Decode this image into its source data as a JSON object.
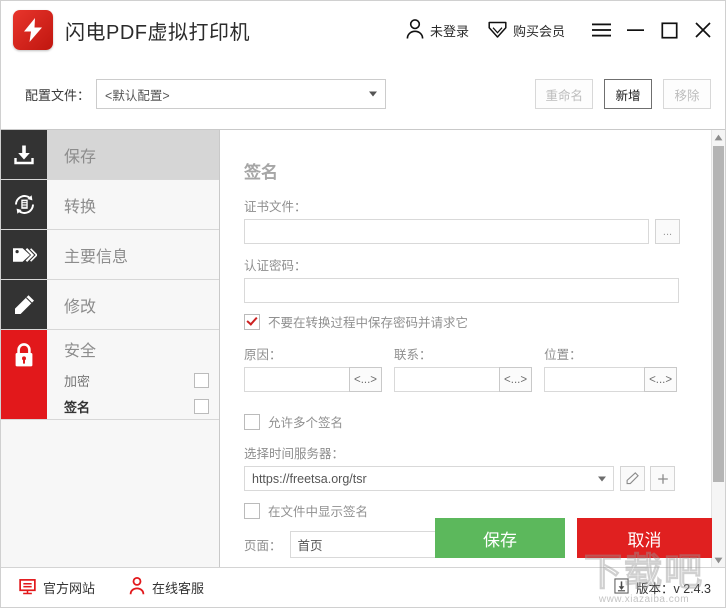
{
  "titlebar": {
    "app_title": "闪电PDF虚拟打印机",
    "logo_icon": "lightning-bolt-logo",
    "login_label": "未登录",
    "login_icon": "person-icon",
    "vip_label": "购买会员",
    "vip_icon": "diamond-icon",
    "menu_icon": "hamburger-menu-icon",
    "minimize_icon": "minimize-icon",
    "maximize_icon": "maximize-icon",
    "close_icon": "close-icon"
  },
  "configbar": {
    "label": "配置文件：",
    "selected_profile": "<默认配置>",
    "rename_label": "重命名",
    "add_label": "新增",
    "remove_label": "移除"
  },
  "sidebar": {
    "items": [
      {
        "label": "保存",
        "icon": "download-icon",
        "active": true
      },
      {
        "label": "转换",
        "icon": "convert-refresh-icon",
        "active": false
      },
      {
        "label": "主要信息",
        "icon": "tags-icon",
        "active": false
      },
      {
        "label": "修改",
        "icon": "pencil-icon",
        "active": false
      }
    ],
    "security": {
      "label": "安全",
      "icon": "lock-icon",
      "sub_items": [
        {
          "label": "加密",
          "checked": false,
          "selected": false
        },
        {
          "label": "签名",
          "checked": false,
          "selected": true
        }
      ]
    }
  },
  "main": {
    "title": "签名",
    "cert_file": {
      "label": "证书文件：",
      "value": "",
      "browse_label": "...",
      "browse_icon": "ellipsis-icon"
    },
    "cert_password": {
      "label": "认证密码：",
      "value": ""
    },
    "no_save_password": {
      "label": "不要在转换过程中保存密码并请求它",
      "checked": true
    },
    "triple_fields": [
      {
        "label": "原因：",
        "value": "",
        "button_label": "<...>"
      },
      {
        "label": "联系：",
        "value": "",
        "button_label": "<...>"
      },
      {
        "label": "位置：",
        "value": "",
        "button_label": "<...>"
      }
    ],
    "allow_multiple_signatures": {
      "label": "允许多个签名",
      "checked": false
    },
    "time_server": {
      "label": "选择时间服务器：",
      "value": "https://freetsa.org/tsr",
      "edit_icon": "pencil-icon",
      "add_icon": "plus-icon"
    },
    "show_signature_in_file": {
      "label": "在文件中显示签名",
      "checked": false
    },
    "page_field": {
      "label": "页面：",
      "value": "首页"
    },
    "save_button": "保存",
    "cancel_button": "取消",
    "scrollbar": {
      "up_icon": "scroll-up-arrow-icon",
      "down_icon": "scroll-down-arrow-icon"
    }
  },
  "footer": {
    "website_label": "官方网站",
    "website_icon": "monitor-icon",
    "support_label": "在线客服",
    "support_icon": "person-icon",
    "version_label": "版本：v 2.4.3",
    "version_icon": "download-arrow-icon"
  },
  "watermark": {
    "big": "下载吧",
    "small": "www.xiazaiba.com"
  },
  "colors": {
    "brand_red": "#e2181b",
    "save_green": "#5cb85c",
    "cancel_red": "#e02020",
    "sidebar_icon_dark": "#333333"
  }
}
